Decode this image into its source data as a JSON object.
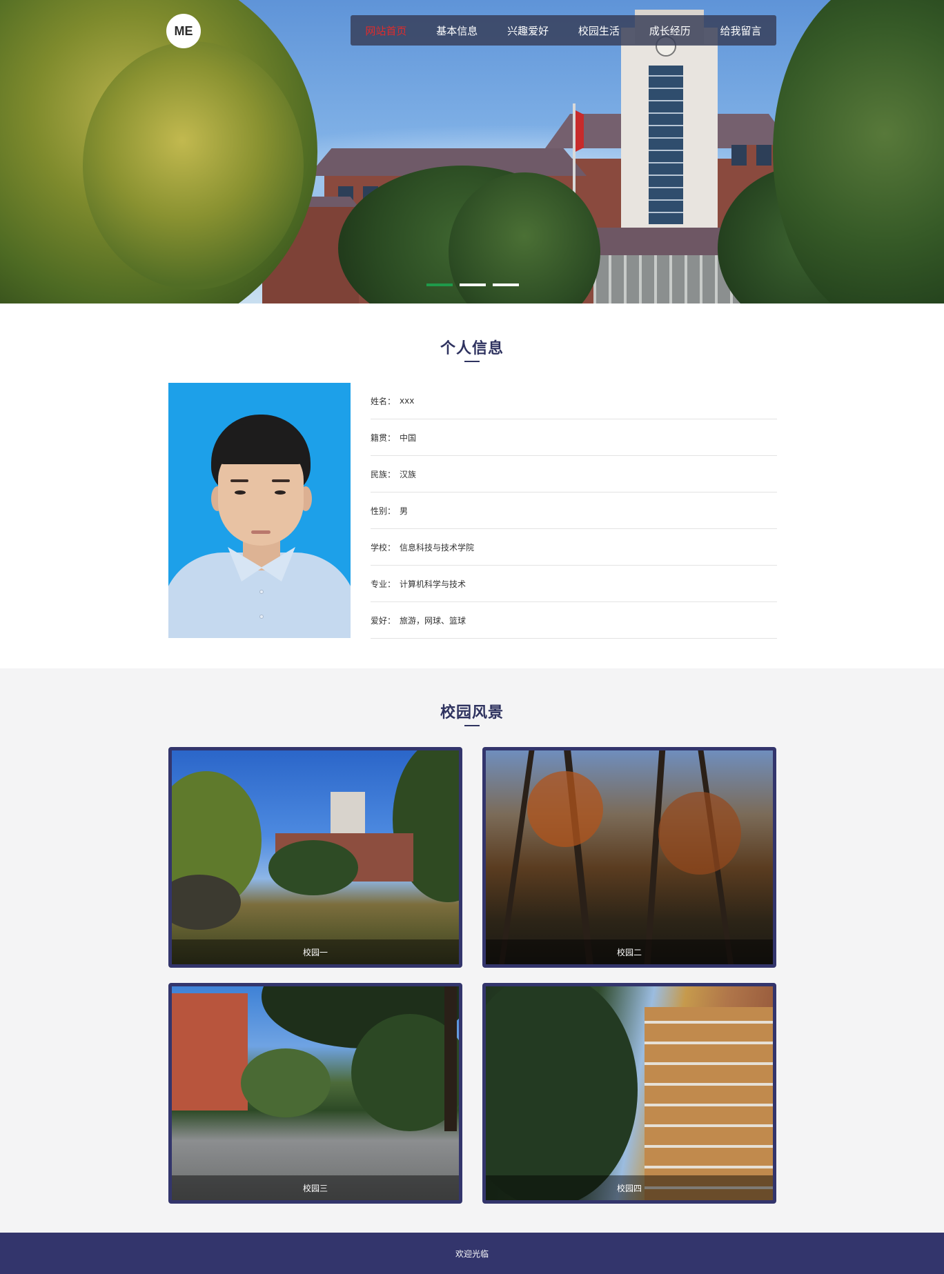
{
  "header": {
    "logo_text": "ME",
    "nav": [
      {
        "label": "网站首页",
        "active": true
      },
      {
        "label": "基本信息",
        "active": false
      },
      {
        "label": "兴趣爱好",
        "active": false
      },
      {
        "label": "校园生活",
        "active": false
      },
      {
        "label": "成长经历",
        "active": false
      },
      {
        "label": "给我留言",
        "active": false
      }
    ],
    "active_color": "#e02b2b"
  },
  "carousel": {
    "slide_count": 3,
    "active_index": 0,
    "active_dot_color": "#1f9a4a"
  },
  "profile": {
    "title": "个人信息",
    "fields": [
      {
        "label": "姓名：",
        "value": "xxx"
      },
      {
        "label": "籍贯：",
        "value": "中国"
      },
      {
        "label": "民族：",
        "value": "汉族"
      },
      {
        "label": "性别：",
        "value": "男"
      },
      {
        "label": "学校：",
        "value": "信息科技与技术学院"
      },
      {
        "label": "专业：",
        "value": "计算机科学与技术"
      },
      {
        "label": "爱好：",
        "value": "旅游，网球、篮球"
      }
    ]
  },
  "scenery": {
    "title": "校园风景",
    "cards": [
      {
        "caption": "校园一"
      },
      {
        "caption": "校园二"
      },
      {
        "caption": "校园三"
      },
      {
        "caption": "校园四"
      }
    ]
  },
  "footer": {
    "text": "欢迎光临"
  },
  "colors": {
    "brand": "#33356c",
    "title": "#2e325f",
    "section_bg": "#f4f4f5"
  }
}
